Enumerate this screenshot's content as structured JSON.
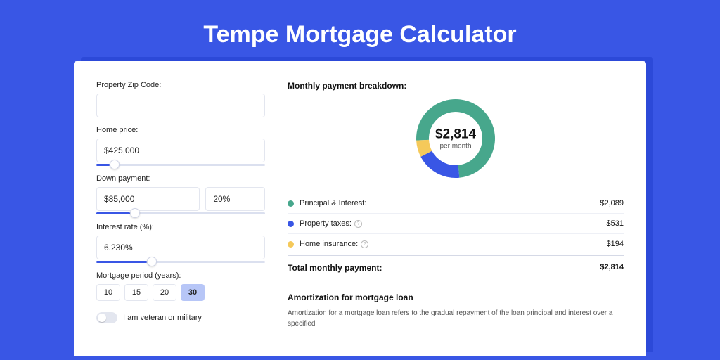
{
  "title": "Tempe Mortgage Calculator",
  "form": {
    "zip": {
      "label": "Property Zip Code:",
      "value": ""
    },
    "home_price": {
      "label": "Home price:",
      "value": "$425,000",
      "slider_pct": 8
    },
    "down_payment": {
      "label": "Down payment:",
      "amount": "$85,000",
      "percent": "20%",
      "slider_pct": 20
    },
    "interest": {
      "label": "Interest rate (%):",
      "value": "6.230%",
      "slider_pct": 30
    },
    "period": {
      "label": "Mortgage period (years):",
      "options": [
        "10",
        "15",
        "20",
        "30"
      ],
      "selected": "30"
    },
    "veteran": {
      "label": "I am veteran or military",
      "on": false
    }
  },
  "breakdown": {
    "title": "Monthly payment breakdown:",
    "center_amount": "$2,814",
    "center_sub": "per month",
    "items": [
      {
        "color": "green",
        "label": "Principal & Interest:",
        "info": false,
        "value": "$2,089"
      },
      {
        "color": "blue",
        "label": "Property taxes:",
        "info": true,
        "value": "$531"
      },
      {
        "color": "yellow",
        "label": "Home insurance:",
        "info": true,
        "value": "$194"
      }
    ],
    "total_label": "Total monthly payment:",
    "total_value": "$2,814"
  },
  "amortization": {
    "title": "Amortization for mortgage loan",
    "text": "Amortization for a mortgage loan refers to the gradual repayment of the loan principal and interest over a specified"
  },
  "chart_data": {
    "type": "pie",
    "title": "Monthly payment breakdown",
    "series": [
      {
        "name": "Principal & Interest",
        "value": 2089,
        "color": "#47a78c"
      },
      {
        "name": "Property taxes",
        "value": 531,
        "color": "#3956e5"
      },
      {
        "name": "Home insurance",
        "value": 194,
        "color": "#f5c95a"
      }
    ],
    "total": 2814
  }
}
